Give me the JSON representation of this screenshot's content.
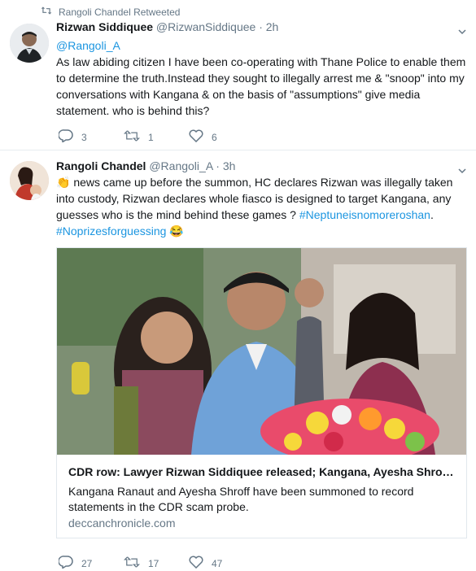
{
  "retweet_context": {
    "label": "Rangoli Chandel Retweeted"
  },
  "tweets": [
    {
      "name": "Rizwan Siddiquee",
      "handle": "@RizwanSiddiquee",
      "time": "· 2h",
      "mention": "@Rangoli_A",
      "text": "As law abiding citizen I have been co-operating with Thane Police to enable them to determine the truth.Instead they sought to illegally arrest me & \"snoop\" into my conversations with Kangana & on the basis of \"assumptions\" give media statement. who is behind this?",
      "replies": "3",
      "retweets": "1",
      "likes": "6"
    },
    {
      "name": "Rangoli Chandel",
      "handle": "@Rangoli_A",
      "time": "· 3h",
      "emoji_wave": "👏",
      "text": " news came  up before the summon, HC declares Rizwan was illegally taken into custody, Rizwan declares whole fiasco is designed to target Kangana, any guesses who is the mind behind these games ? ",
      "hashtag1": "#Neptuneisnomoreroshan",
      "sep": ".",
      "hashtag2": "#Noprizesforguessing",
      "emoji_laugh": "😂",
      "card": {
        "title": "CDR row: Lawyer Rizwan Siddiquee released; Kangana, Ayesha Shroff have been summoned",
        "description": "Kangana Ranaut and Ayesha Shroff have been summoned to record statements in the CDR scam probe.",
        "domain": "deccanchronicle.com"
      },
      "replies": "27",
      "retweets": "17",
      "likes": "47"
    }
  ],
  "colors": {
    "link": "#1b95e0",
    "secondary": "#657786",
    "divider": "#e6ecf0"
  },
  "icons": [
    "retweet-icon",
    "reply-icon",
    "heart-icon",
    "chevron-down-icon"
  ]
}
